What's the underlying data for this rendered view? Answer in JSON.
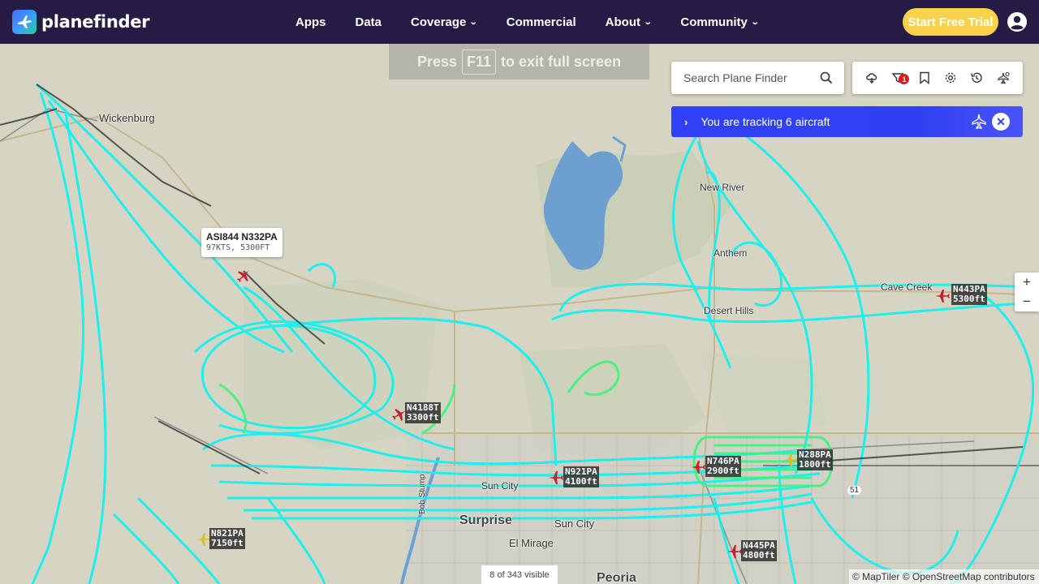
{
  "brand": {
    "name": "planefinder"
  },
  "nav": {
    "items": [
      {
        "label": "Apps",
        "dropdown": false
      },
      {
        "label": "Data",
        "dropdown": false
      },
      {
        "label": "Coverage",
        "dropdown": true
      },
      {
        "label": "Commercial",
        "dropdown": false
      },
      {
        "label": "About",
        "dropdown": true
      },
      {
        "label": "Community",
        "dropdown": true
      }
    ],
    "trial_button": "Start Free Trial"
  },
  "fullscreen_hint": {
    "before": "Press",
    "key": "F11",
    "after": "to exit full screen"
  },
  "search": {
    "placeholder": "Search Plane Finder"
  },
  "toolbar": {
    "icons": [
      "weather-icon",
      "filter-icon",
      "bookmark-icon",
      "settings-icon",
      "history-icon",
      "aircraft-tools-icon"
    ],
    "filter_badge": "1"
  },
  "tracking": {
    "text": "You are tracking 6 aircraft"
  },
  "zoom": {
    "in": "+",
    "out": "−"
  },
  "popup": {
    "callsign": "ASI844 N332PA",
    "details": "97KTS, 5300FT"
  },
  "aircraft": [
    {
      "reg": "N4188T",
      "alt": "3300ft",
      "color": "#c8202e"
    },
    {
      "reg": "N921PA",
      "alt": "4100ft",
      "color": "#c8202e"
    },
    {
      "reg": "N746PA",
      "alt": "2900ft",
      "color": "#c8202e"
    },
    {
      "reg": "N288PA",
      "alt": "1800ft",
      "color": "#d8c02a"
    },
    {
      "reg": "N443PA",
      "alt": "5300ft",
      "color": "#c8202e"
    },
    {
      "reg": "N821PA",
      "alt": "7150ft",
      "color": "#d8c02a"
    },
    {
      "reg": "N445PA",
      "alt": "4800ft",
      "color": "#c8202e"
    }
  ],
  "places": {
    "wickenburg": "Wickenburg",
    "new_river": "New River",
    "anthem": "Anthem",
    "desert_hills": "Desert Hills",
    "cave_creek": "Cave Creek",
    "surprise": "Surprise",
    "sun_city": "Sun City",
    "el_mirage": "El Mirage",
    "peoria": "Peoria",
    "sun_city_west": "Sun City",
    "road_51": "51",
    "bob_stump": "Bob Stump"
  },
  "map_footer": {
    "visible_count": "8 of 343 visible",
    "attribution": "© MapTiler © OpenStreetMap contributors"
  },
  "colors": {
    "nav_bg": "#251b45",
    "track_cyan": "#16f0f0",
    "track_green": "#3cf37a",
    "tracking_bar": "#2f40f2",
    "trial_button": "#f7d24a"
  }
}
